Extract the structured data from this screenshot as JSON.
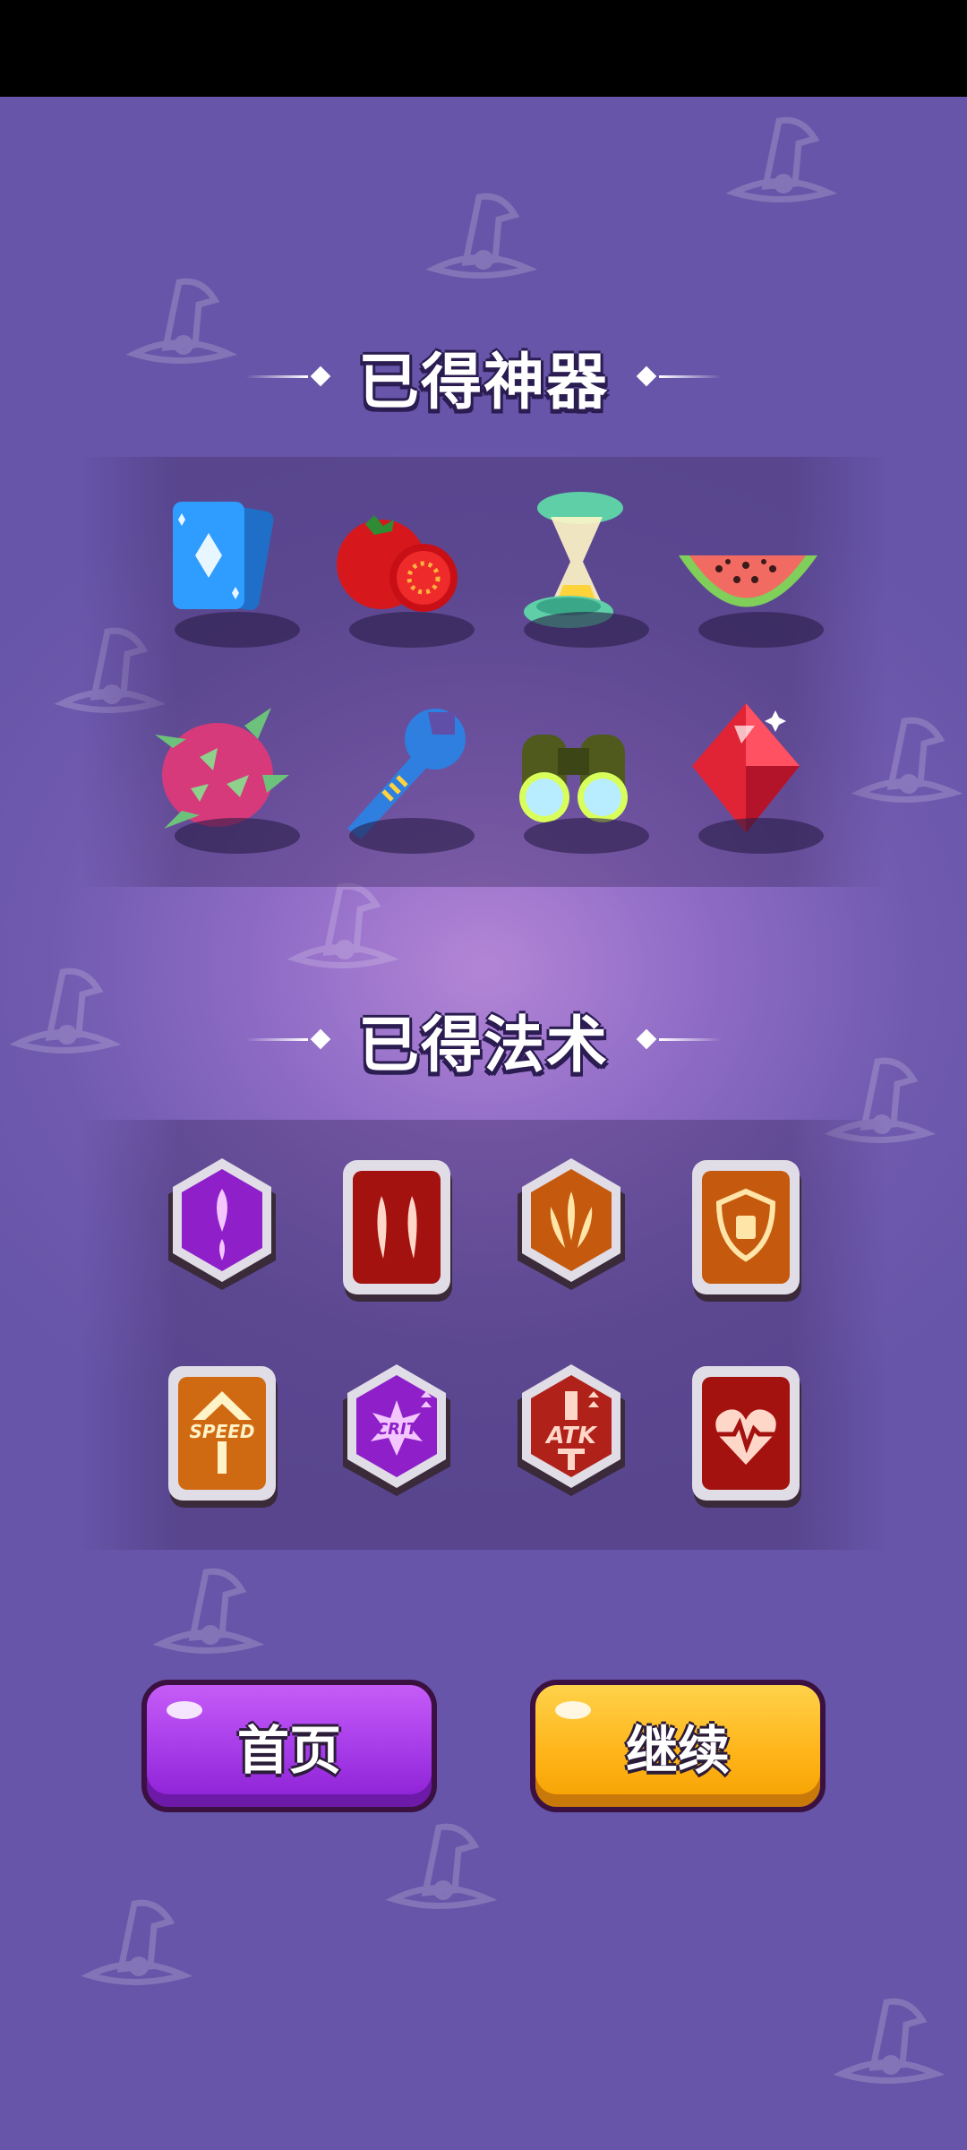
{
  "artifacts_section": {
    "title": "已得神器"
  },
  "artifacts": [
    {
      "icon": "diamond-card-icon"
    },
    {
      "icon": "tomato-icon"
    },
    {
      "icon": "hourglass-icon"
    },
    {
      "icon": "watermelon-icon"
    },
    {
      "icon": "dragon-fruit-icon"
    },
    {
      "icon": "wrench-icon"
    },
    {
      "icon": "binoculars-icon"
    },
    {
      "icon": "red-gem-icon"
    }
  ],
  "spells_section": {
    "title": "已得法术"
  },
  "spells": [
    {
      "icon": "purple-missile-spell-icon"
    },
    {
      "icon": "red-double-claw-spell-icon"
    },
    {
      "icon": "orange-triple-shot-spell-icon"
    },
    {
      "icon": "orange-shield-spell-icon"
    },
    {
      "icon": "speed-up-spell-icon",
      "label": "SPEED"
    },
    {
      "icon": "crit-up-spell-icon",
      "label": "CRIT"
    },
    {
      "icon": "atk-up-spell-icon",
      "label": "ATK"
    },
    {
      "icon": "heart-health-spell-icon"
    }
  ],
  "buttons": {
    "home": "首页",
    "continue": "继续"
  },
  "colors": {
    "background": "#6f5aae",
    "home_button": "#a53ae8",
    "continue_button": "#ffb51a"
  }
}
